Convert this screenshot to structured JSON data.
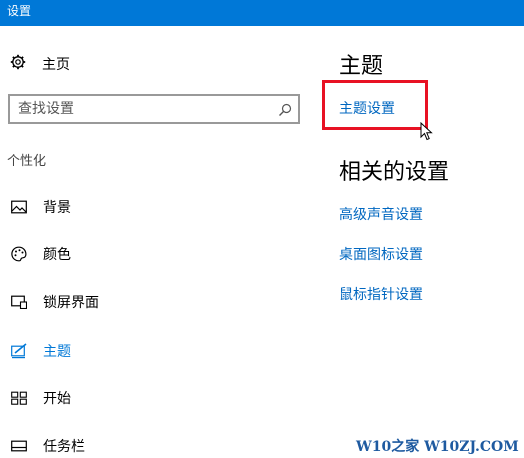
{
  "window": {
    "title": "设置"
  },
  "sidebar": {
    "home_label": "主页",
    "search": {
      "placeholder": "查找设置",
      "value": ""
    },
    "section_label": "个性化",
    "items": [
      {
        "label": "背景",
        "icon": "picture-icon"
      },
      {
        "label": "颜色",
        "icon": "palette-icon"
      },
      {
        "label": "锁屏界面",
        "icon": "lock-screen-icon"
      },
      {
        "label": "主题",
        "icon": "theme-brush-icon",
        "active": true
      },
      {
        "label": "开始",
        "icon": "start-tiles-icon"
      },
      {
        "label": "任务栏",
        "icon": "taskbar-icon"
      }
    ]
  },
  "main": {
    "heading": "主题",
    "theme_settings_link": "主题设置",
    "related_heading": "相关的设置",
    "related_links": [
      "高级声音设置",
      "桌面图标设置",
      "鼠标指针设置"
    ]
  },
  "watermark": "W10之家 W10ZJ.COM",
  "colors": {
    "titlebar": "#0078d7",
    "link": "#0067c0",
    "highlight": "#e81123",
    "active_nav": "#0078d7"
  }
}
